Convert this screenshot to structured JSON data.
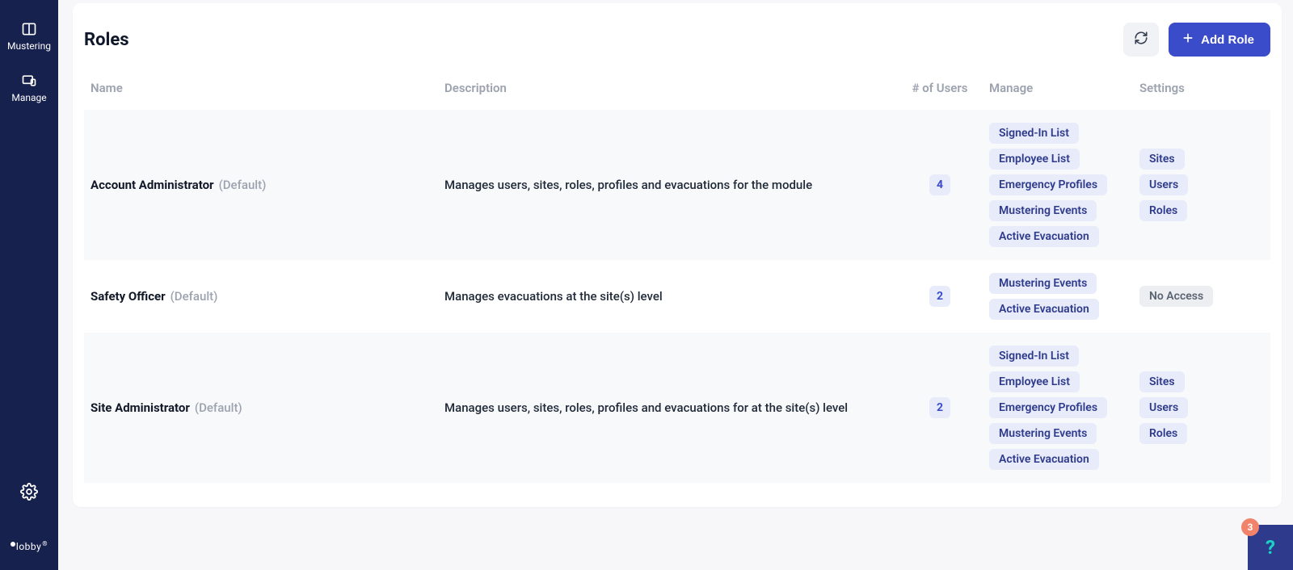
{
  "sidebar": {
    "items": [
      {
        "label": "Mustering"
      },
      {
        "label": "Manage"
      }
    ],
    "brand": "lobby"
  },
  "header": {
    "title": "Roles",
    "add_button": "Add Role"
  },
  "table": {
    "columns": {
      "name": "Name",
      "description": "Description",
      "users": "# of Users",
      "manage": "Manage",
      "settings": "Settings"
    }
  },
  "roles": [
    {
      "name": "Account Administrator",
      "default_tag": "(Default)",
      "description": "Manages users, sites, roles, profiles and evacuations for the module",
      "user_count": "4",
      "manage": [
        "Signed-In List",
        "Employee List",
        "Emergency Profiles",
        "Mustering Events",
        "Active Evacuation"
      ],
      "settings": [
        "Sites",
        "Users",
        "Roles"
      ],
      "settings_none": null
    },
    {
      "name": "Safety Officer",
      "default_tag": "(Default)",
      "description": "Manages evacuations at the site(s) level",
      "user_count": "2",
      "manage": [
        "Mustering Events",
        "Active Evacuation"
      ],
      "settings": [],
      "settings_none": "No Access"
    },
    {
      "name": "Site Administrator",
      "default_tag": "(Default)",
      "description": "Manages users, sites, roles, profiles and evacuations for at the site(s) level",
      "user_count": "2",
      "manage": [
        "Signed-In List",
        "Employee List",
        "Emergency Profiles",
        "Mustering Events",
        "Active Evacuation"
      ],
      "settings": [
        "Sites",
        "Users",
        "Roles"
      ],
      "settings_none": null
    }
  ],
  "help": {
    "badge": "3",
    "glyph": "?"
  }
}
